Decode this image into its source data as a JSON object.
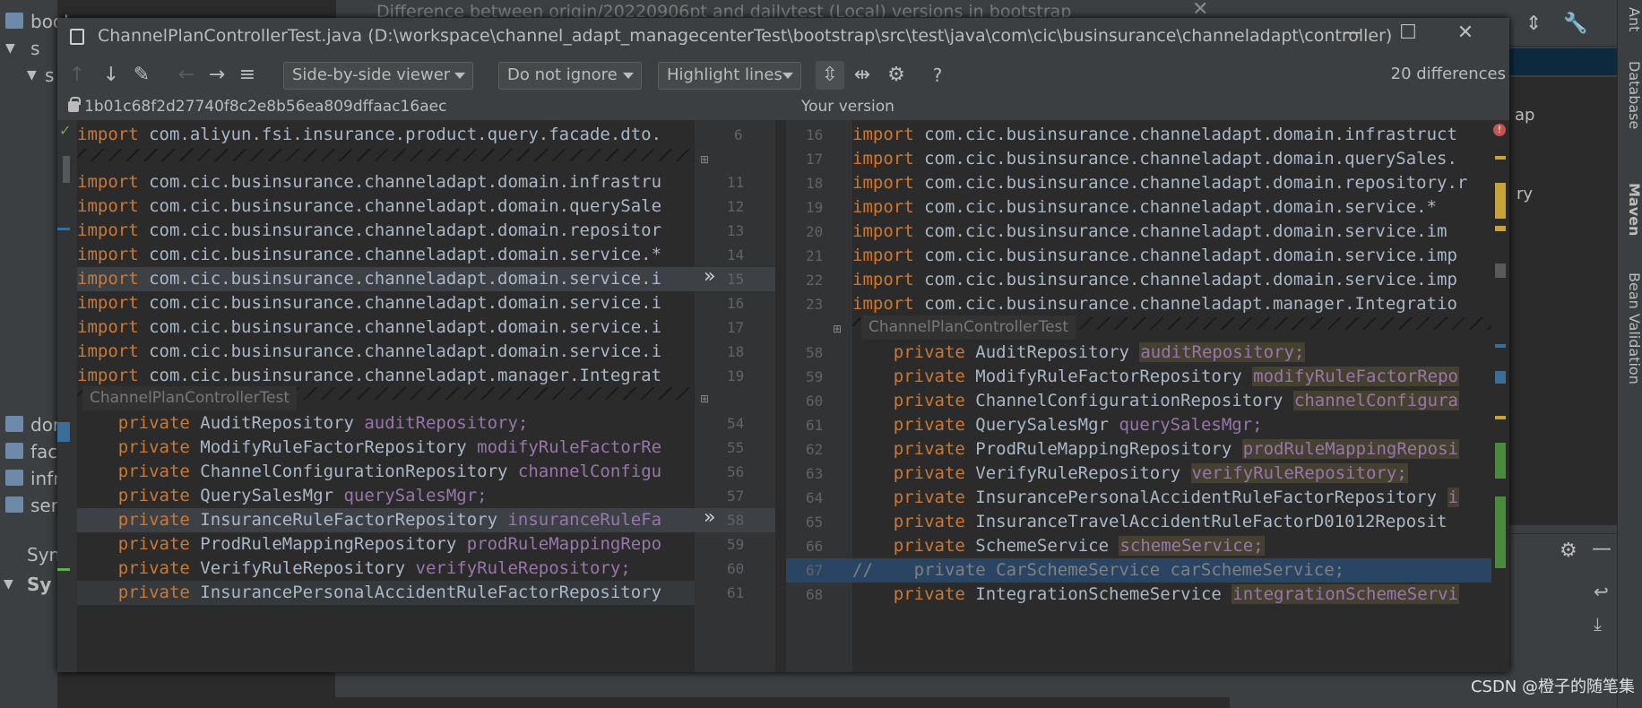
{
  "background": {
    "bg_dialog_title": "Difference between origin/20220906pt and dailytest (Local) versions in bootstrap",
    "left_tree": [
      {
        "label": "boot"
      },
      {
        "label": "s"
      },
      {
        "label": "s"
      },
      {
        "label": "dor"
      },
      {
        "label": "faca"
      },
      {
        "label": "infr"
      },
      {
        "label": "serv"
      }
    ],
    "left_sync_label": "Syn",
    "left_sync_sub": "Sy",
    "right_strip_tabs": [
      "Ant",
      "Database",
      "Maven",
      "Bean Validation"
    ],
    "right_peek_labels": [
      "ap",
      "ry"
    ]
  },
  "diff_window": {
    "title": "ChannelPlanControllerTest.java (D:\\workspace\\channel_adapt_managecenterTest\\bootstrap\\src\\test\\java\\com\\cic\\businsurance\\channeladapt\\controller)",
    "window_buttons": {
      "minimize": "—",
      "maximize": "☐",
      "close": "✕"
    },
    "toolbar": {
      "viewer_mode": "Side-by-side viewer",
      "ignore_mode": "Do not ignore",
      "highlight_mode": "Highlight lines",
      "help": "?",
      "differences": "20 differences"
    },
    "left_header": "1b01c68f2d27740f8c2e8b56ea809dffaac16aec",
    "right_header": "Your version",
    "section_label": "ChannelPlanControllerTest"
  },
  "left_lines": [
    {
      "num": "6",
      "pkg": "com.aliyun.fsi.insurance.product.query.facade.dto."
    },
    {
      "num": "11",
      "pkg": "com.cic.businsurance.channeladapt.domain.infrastru"
    },
    {
      "num": "12",
      "pkg": "com.cic.businsurance.channeladapt.domain.querySale"
    },
    {
      "num": "13",
      "pkg": "com.cic.businsurance.channeladapt.domain.repositor"
    },
    {
      "num": "14",
      "pkg": "com.cic.businsurance.channeladapt.domain.service.*"
    },
    {
      "num": "15",
      "pkg": "com.cic.businsurance.channeladapt.domain.service.i"
    },
    {
      "num": "16",
      "pkg": "com.cic.businsurance.channeladapt.domain.service.i"
    },
    {
      "num": "17",
      "pkg": "com.cic.businsurance.channeladapt.domain.service.i"
    },
    {
      "num": "18",
      "pkg": "com.cic.businsurance.channeladapt.domain.service.i"
    },
    {
      "num": "19",
      "pkg": "com.cic.businsurance.channeladapt.manager.Integrat"
    }
  ],
  "left_fields": [
    {
      "num": "54",
      "type": "AuditRepository",
      "name": "auditRepository;"
    },
    {
      "num": "55",
      "type": "ModifyRuleFactorRepository",
      "name": "modifyRuleFactorRe"
    },
    {
      "num": "56",
      "type": "ChannelConfigurationRepository",
      "name": "channelConfigu"
    },
    {
      "num": "57",
      "type": "QuerySalesMgr",
      "name": "querySalesMgr;"
    },
    {
      "num": "58",
      "type": "InsuranceRuleFactorRepository",
      "name": "insuranceRuleFa"
    },
    {
      "num": "59",
      "type": "ProdRuleMappingRepository",
      "name": "prodRuleMappingRepo"
    },
    {
      "num": "60",
      "type": "VerifyRuleRepository",
      "name": "verifyRuleRepository;"
    },
    {
      "num": "61",
      "type": "InsurancePersonalAccidentRuleFactorRepository",
      "name": ""
    }
  ],
  "right_lines": [
    {
      "num": "16",
      "pkg": "com.cic.businsurance.channeladapt.domain.infrastruct"
    },
    {
      "num": "17",
      "pkg": "com.cic.businsurance.channeladapt.domain.querySales."
    },
    {
      "num": "18",
      "pkg": "com.cic.businsurance.channeladapt.domain.repository.r"
    },
    {
      "num": "19",
      "pkg": "com.cic.businsurance.channeladapt.domain.service.*"
    },
    {
      "num": "20",
      "pkg": "com.cic.businsurance.channeladapt.domain.service.im"
    },
    {
      "num": "21",
      "pkg": "com.cic.businsurance.channeladapt.domain.service.imp"
    },
    {
      "num": "22",
      "pkg": "com.cic.businsurance.channeladapt.domain.service.imp"
    },
    {
      "num": "23",
      "pkg": "com.cic.businsurance.channeladapt.manager.Integratio"
    }
  ],
  "right_fields": [
    {
      "num": "58",
      "type": "AuditRepository",
      "name": "auditRepository;"
    },
    {
      "num": "59",
      "type": "ModifyRuleFactorRepository",
      "name": "modifyRuleFactorRepo"
    },
    {
      "num": "60",
      "type": "ChannelConfigurationRepository",
      "name": "channelConfigura"
    },
    {
      "num": "61",
      "type": "QuerySalesMgr",
      "name": "querySalesMgr;"
    },
    {
      "num": "62",
      "type": "ProdRuleMappingRepository",
      "name": "prodRuleMappingReposi"
    },
    {
      "num": "63",
      "type": "VerifyRuleRepository",
      "name": "verifyRuleRepository;"
    },
    {
      "num": "64",
      "type": "InsurancePersonalAccidentRuleFactorRepository",
      "name": "i"
    },
    {
      "num": "65",
      "type": "InsuranceTravelAccidentRuleFactorD01012Reposit",
      "name": ""
    },
    {
      "num": "66",
      "type": "SchemeService",
      "name": "schemeService;"
    },
    {
      "num": "67",
      "comment": "//    private CarSchemeService carSchemeService;"
    },
    {
      "num": "68",
      "type": "IntegrationSchemeService",
      "name": "integrationSchemeServi"
    }
  ],
  "keywords": {
    "import": "import",
    "private": "private"
  },
  "watermark": "CSDN @橙子的随笔集"
}
